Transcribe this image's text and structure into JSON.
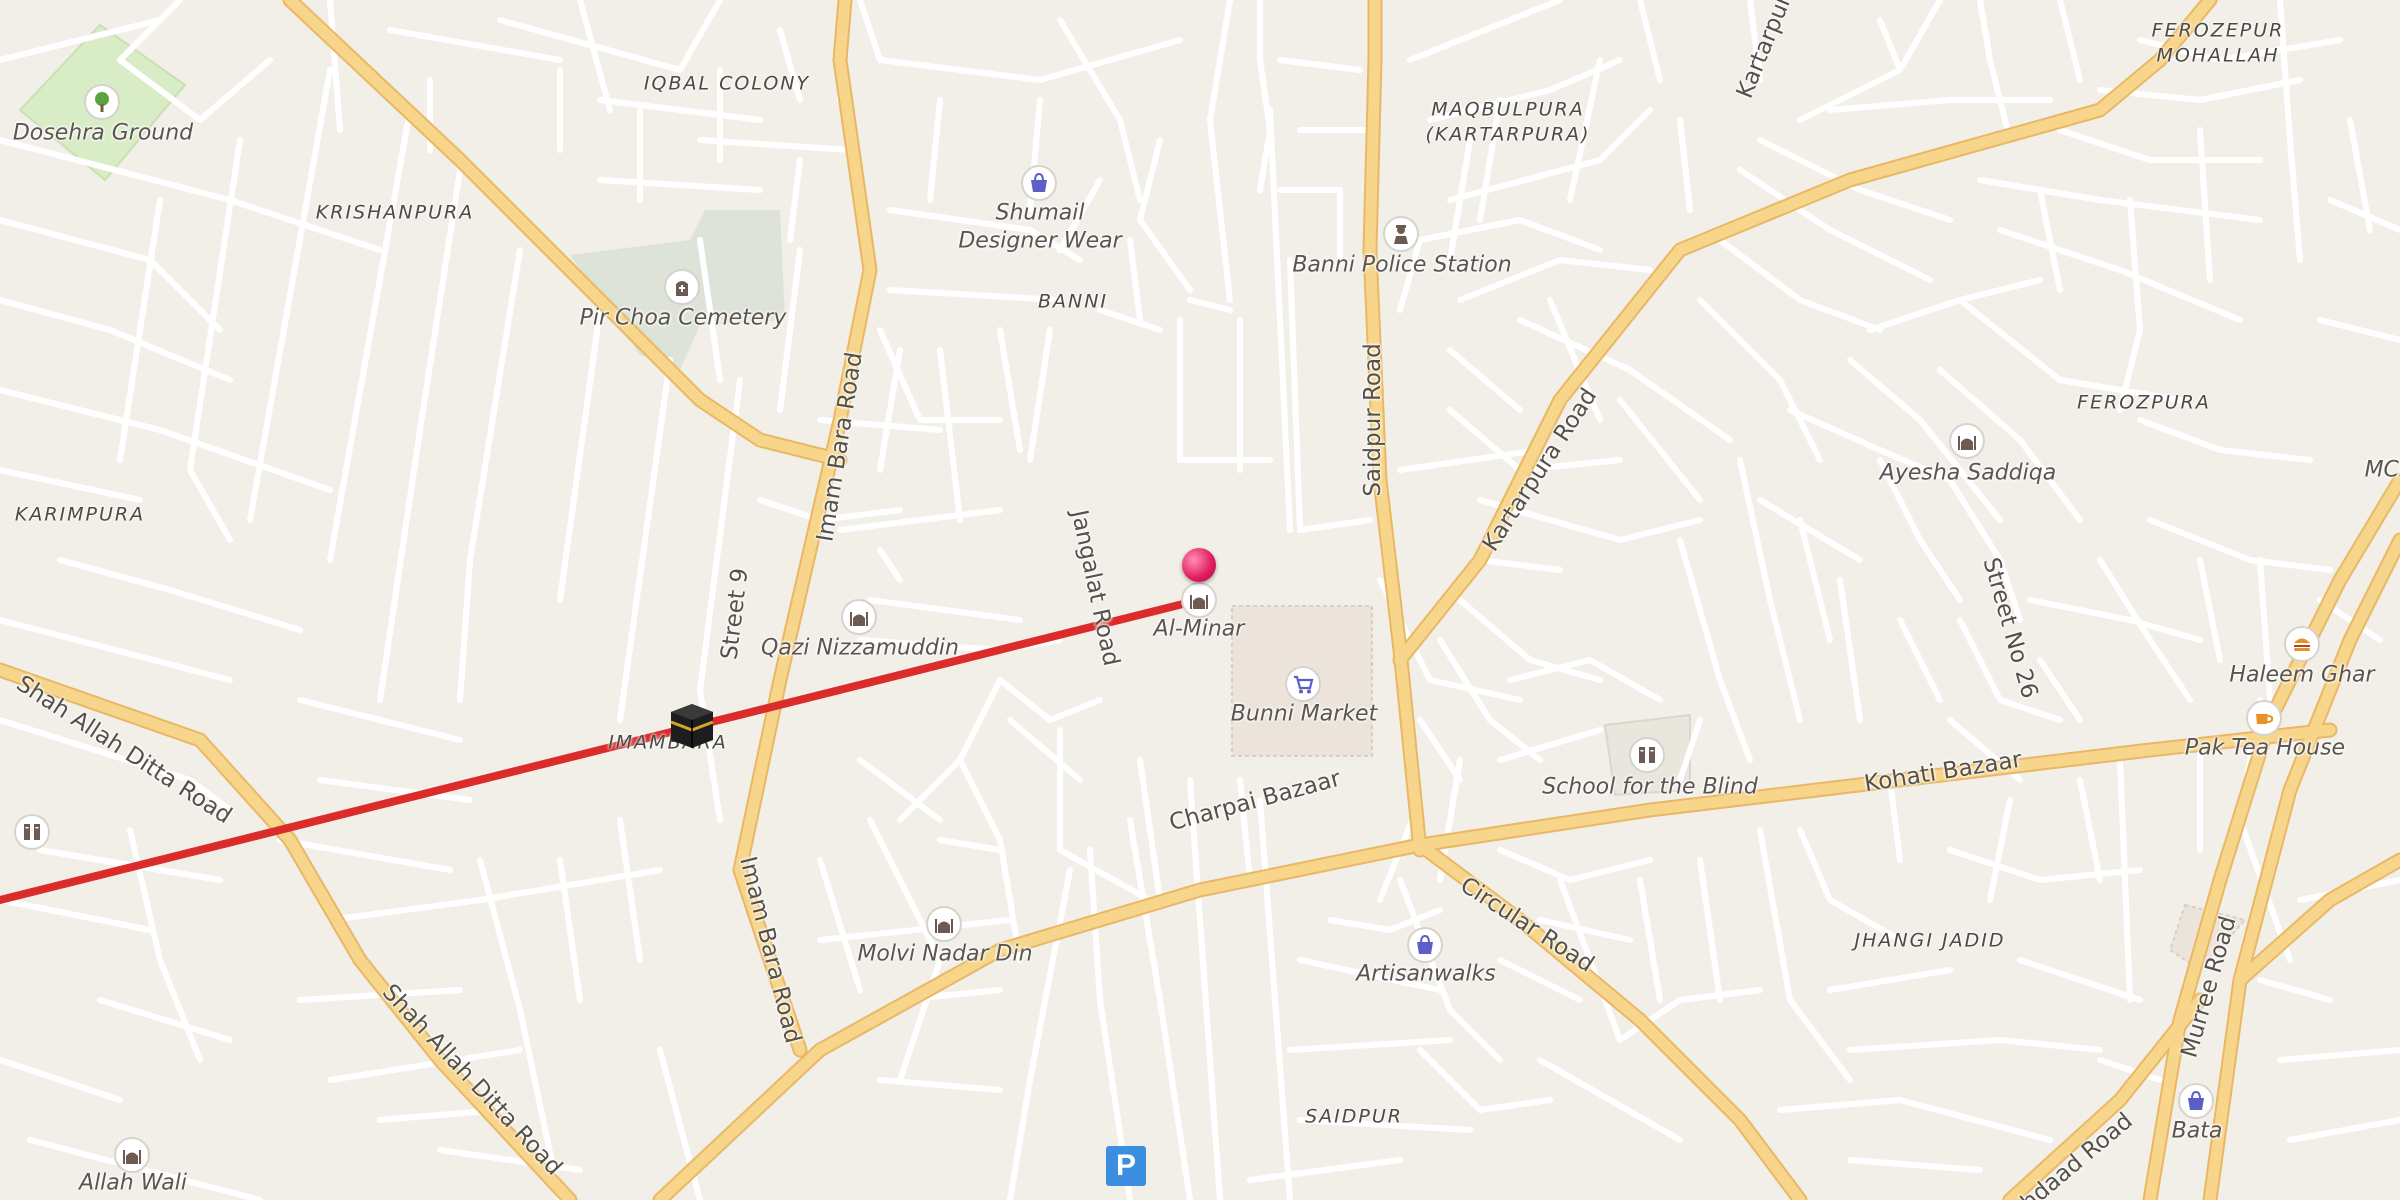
{
  "colors": {
    "background": "#f2efe9",
    "minor_road": "#ffffff",
    "major_road": "#f7d58a",
    "major_road_casing": "#e8b866",
    "park": "#d8ecc5",
    "cemetery": "#dde3d8",
    "route_line": "#dc2b2b",
    "pin": "#e0195d",
    "shop_icon": "#5b5fc7",
    "poi_icon": "#6d5a52"
  },
  "area_labels": {
    "iqbal_colony": "IQBAL COLONY",
    "krishanpura": "KRISHANPURA",
    "karimpura": "KARIMPURA",
    "banni": "BANNI",
    "maqbulpura": "MAQBULPURA\n(KARTARPURA)",
    "ferozepur_mohallah": "FEROZEPUR\nMOHALLAH",
    "ferozpura": "FEROZPURA",
    "jhangi_jadid": "JHANGI JADID",
    "saidpur": "SAIDPUR",
    "imambara": "IMAMBARA"
  },
  "road_labels": {
    "imam_bara_road_north": "Imam Bara Road",
    "imam_bara_road_south": "Imam Bara Road",
    "jangalat_road": "Jangalat Road",
    "saidpur_road": "Saidpur Road",
    "kartarpura_road": "Kartarpura Road",
    "kartarpura_top": "Kartarpura",
    "street_9": "Street 9",
    "street_no_26": "Street No 26",
    "shah_allah_ditta_road_west": "Shah Allah Ditta Road",
    "shah_allah_ditta_road_south": "Shah Allah Ditta Road",
    "charpai_bazaar": "Charpai Bazaar",
    "circular_road": "Circular Road",
    "kohati_bazaar": "Kohati Bazaar",
    "murree_road": "Murree Road",
    "jahdaad_road": "hdaad Road"
  },
  "pois": {
    "dosehra_ground": "Dosehra Ground",
    "pir_choa_cemetery": "Pir Choa Cemetery",
    "shumail_designer_wear": "Shumail\nDesigner Wear",
    "banni_police_station": "Banni Police Station",
    "al_minar": "Al-Minar",
    "bunni_market": "Bunni Market",
    "qazi_nizzamuddin": "Qazi Nizzamuddin",
    "molvi_nadar_din": "Molvi Nadar Din",
    "artisanwalks": "Artisanwalks",
    "school_for_the_blind": "School for the Blind",
    "ayesha_saddiqa": "Ayesha Saddiqa",
    "haleem_ghar": "Haleem Ghar",
    "pak_tea_house": "Pak Tea House",
    "bata": "Bata",
    "allah_wali": "Allah Wali",
    "mcb_partial": "MCI"
  },
  "icons": {
    "park": "tree-icon",
    "cemetery": "cemetery-icon",
    "shop": "shopping-bag-icon",
    "police": "police-icon",
    "mosque": "mosque-icon",
    "market": "shopping-cart-icon",
    "school": "school-icon",
    "food": "burger-icon",
    "cafe": "cafe-icon",
    "parking": "P",
    "qibla": "kaaba-icon",
    "pin": "location-pin-icon"
  }
}
